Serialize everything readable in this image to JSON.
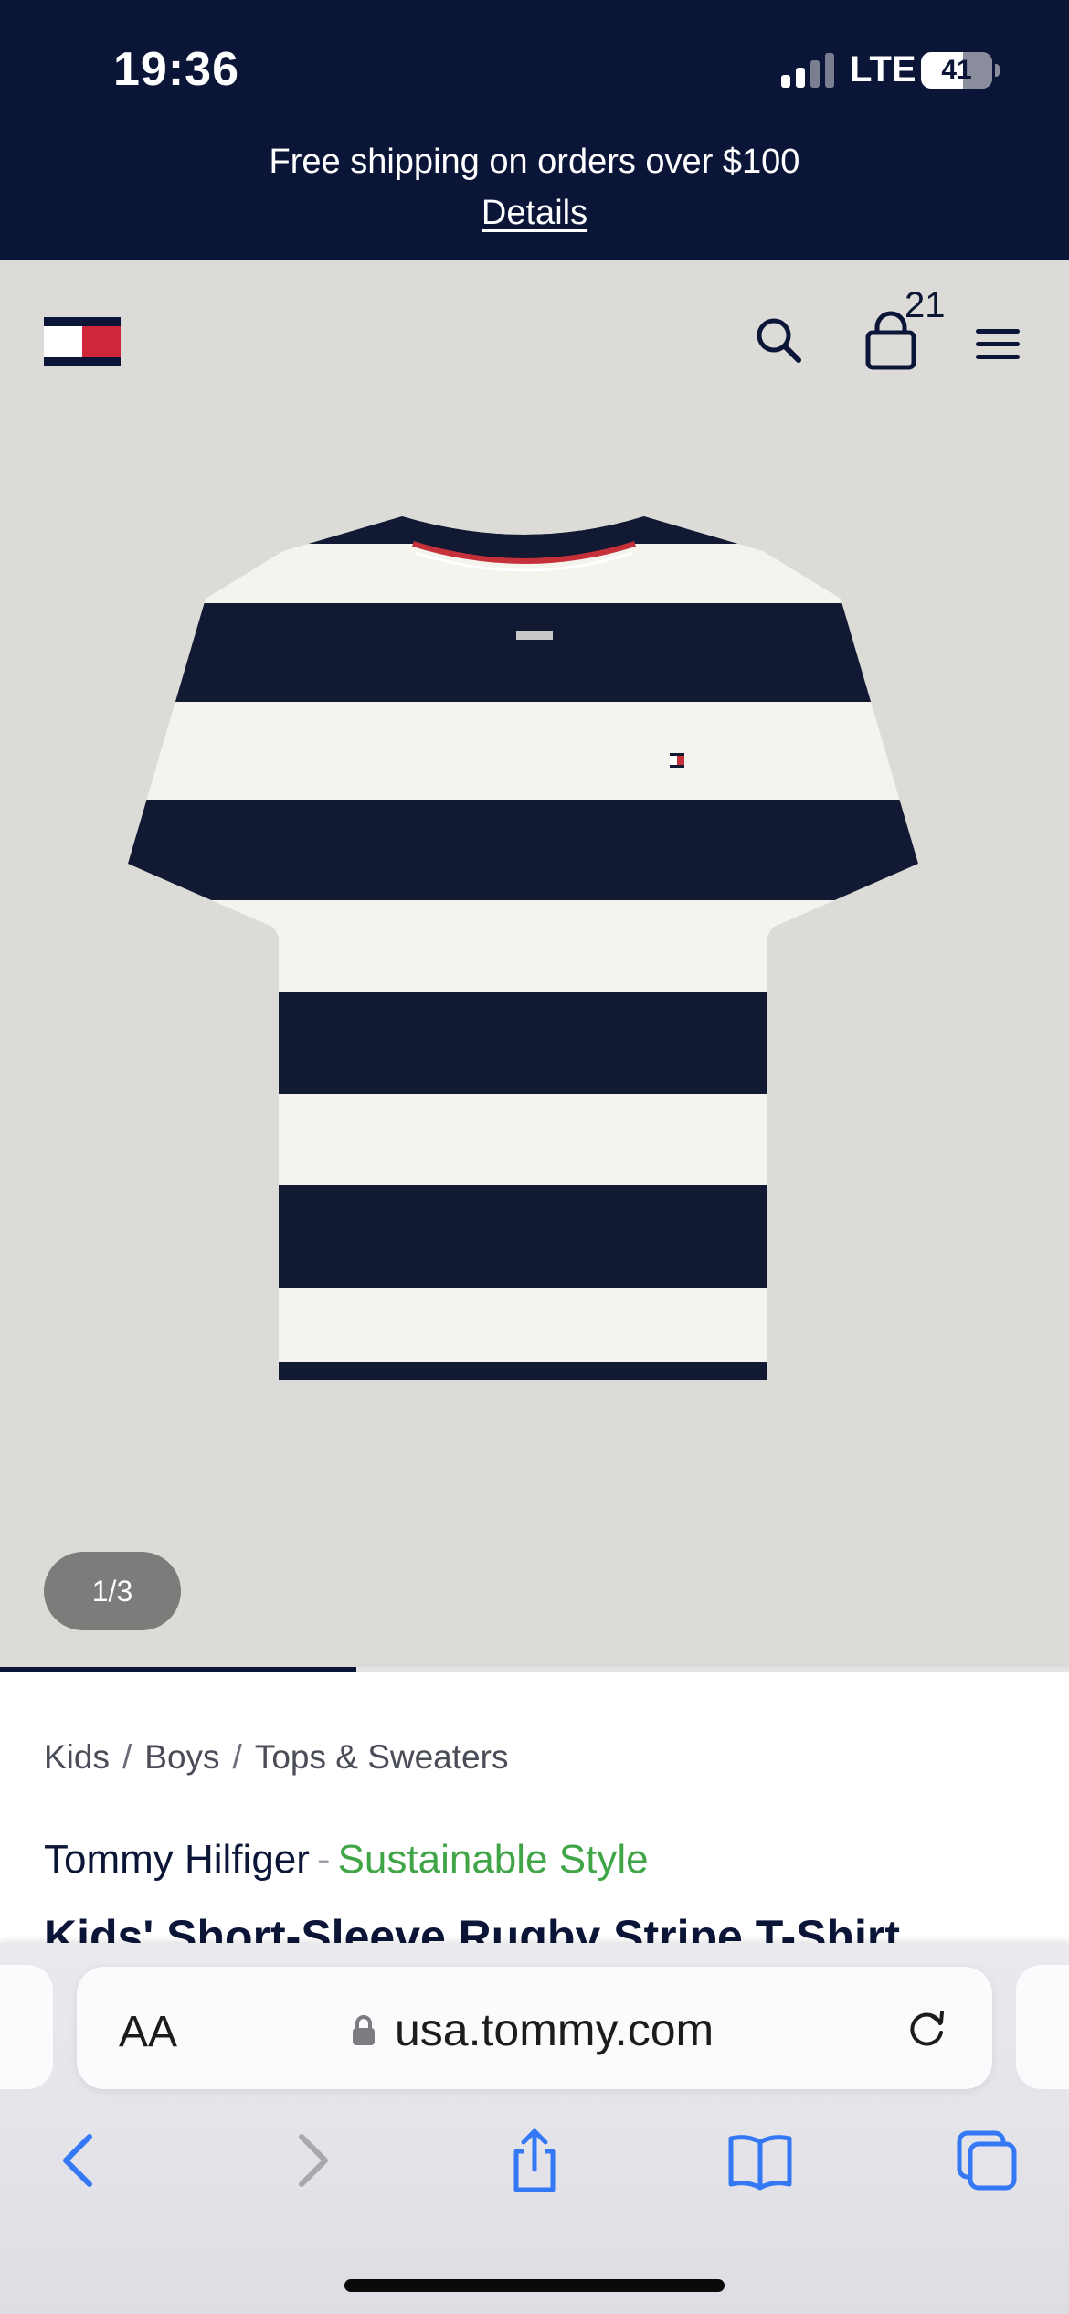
{
  "status_bar": {
    "time": "19:36",
    "network": "LTE",
    "battery_level": "41"
  },
  "promo": {
    "text": "Free shipping on orders over $100",
    "link": "Details"
  },
  "header": {
    "logo_icon": "tommy-flag-logo",
    "icons": [
      "search-icon",
      "shopping-bag-icon",
      "hamburger-menu-icon"
    ],
    "bag_count": "21"
  },
  "gallery": {
    "counter": "1/3",
    "progress": 0.333
  },
  "breadcrumb": {
    "items": [
      "Kids",
      "Boys",
      "Tops & Sweaters"
    ],
    "separator": "/"
  },
  "product": {
    "brand": "Tommy Hilfiger",
    "dash": "-",
    "sustainable": "Sustainable Style",
    "title": "Kids' Short-Sleeve Rugby Stripe T-Shirt"
  },
  "browser": {
    "text_size_label": "AA",
    "url": "usa.tommy.com",
    "toolbar": [
      "back-icon",
      "forward-icon",
      "share-icon",
      "bookmarks-icon",
      "tabs-icon"
    ]
  },
  "colors": {
    "navy": "#0b1537",
    "red": "#d0263a",
    "green": "#3fa547",
    "product_bg": "#dcdbd8",
    "safari_blue": "#3478f6"
  }
}
